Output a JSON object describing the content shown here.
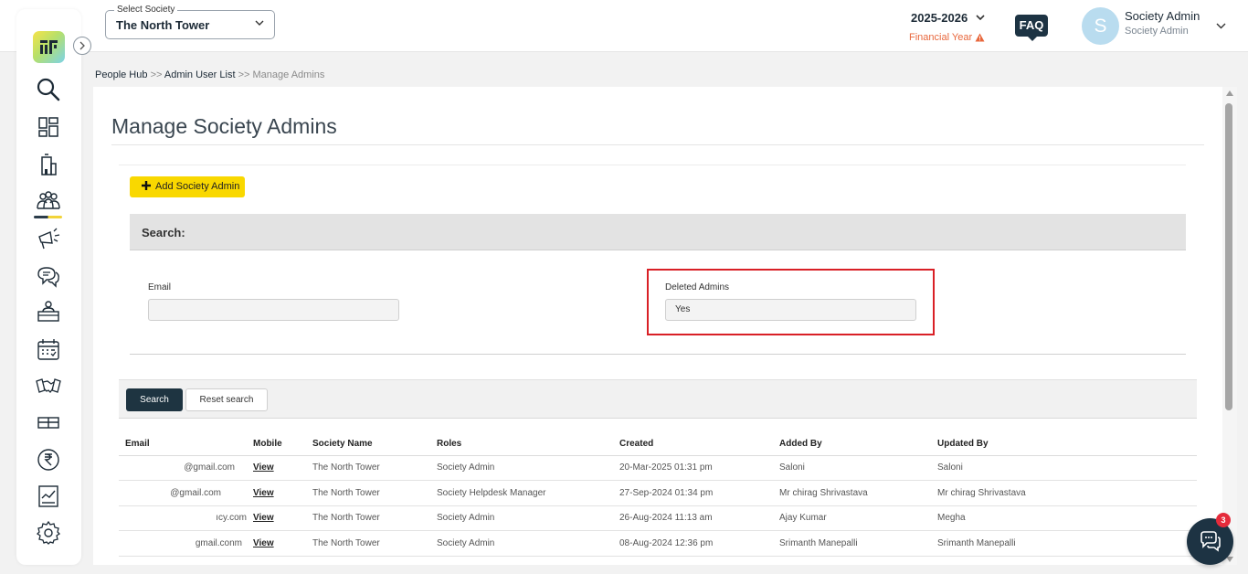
{
  "header": {
    "society_select_label": "Select Society",
    "society_select_value": "The North Tower",
    "financial_year": "2025-2026",
    "financial_year_label": "Financial Year",
    "faq_label": "FAQ",
    "avatar_letter": "S",
    "user_name": "Society Admin",
    "user_role": "Society Admin"
  },
  "sidebar": {
    "items": [
      "search-icon",
      "dashboard-icon",
      "building-icon",
      "people-icon",
      "announcement-icon",
      "chat-bubbles-icon",
      "reception-icon",
      "calendar-icon",
      "handshake-icon",
      "parcel-icon",
      "rupee-icon",
      "report-icon",
      "settings-icon"
    ],
    "active": "people-icon"
  },
  "breadcrumb": {
    "items": [
      "People Hub",
      "Admin User List",
      "Manage Admins"
    ],
    "separator": ">>"
  },
  "page": {
    "title": "Manage Society Admins",
    "add_button": "Add Society Admin"
  },
  "search": {
    "heading": "Search:",
    "email_label": "Email",
    "email_value": "",
    "deleted_label": "Deleted Admins",
    "deleted_value": "Yes",
    "search_button": "Search",
    "reset_button": "Reset search"
  },
  "table": {
    "columns": [
      "Email",
      "Mobile",
      "Society Name",
      "Roles",
      "Created",
      "Added By",
      "Updated By"
    ],
    "rows": [
      {
        "email": "@gmail.com",
        "mobile": "View",
        "society": "The North Tower",
        "role": "Society Admin",
        "created": "20-Mar-2025 01:31 pm",
        "added_by": "Saloni",
        "updated_by": "Saloni"
      },
      {
        "email": "@gmail.com",
        "mobile": "View",
        "society": "The North Tower",
        "role": "Society Helpdesk Manager",
        "created": "27-Sep-2024 01:34 pm",
        "added_by": "Mr chirag Shrivastava",
        "updated_by": "Mr chirag Shrivastava"
      },
      {
        "email": "ıcy.com",
        "mobile": "View",
        "society": "The North Tower",
        "role": "Society Admin",
        "created": "26-Aug-2024 11:13 am",
        "added_by": "Ajay Kumar",
        "updated_by": "Megha"
      },
      {
        "email": "gmail.conm",
        "mobile": "View",
        "society": "The North Tower",
        "role": "Society Admin",
        "created": "08-Aug-2024 12:36 pm",
        "added_by": "Srimanth Manepalli",
        "updated_by": "Srimanth Manepalli"
      }
    ]
  },
  "chat": {
    "badge_count": "3"
  },
  "colors": {
    "accent_yellow": "#f9d800",
    "dark_navy": "#1e3441",
    "highlight_red": "#d92026",
    "warning_orange": "#e8673c"
  }
}
